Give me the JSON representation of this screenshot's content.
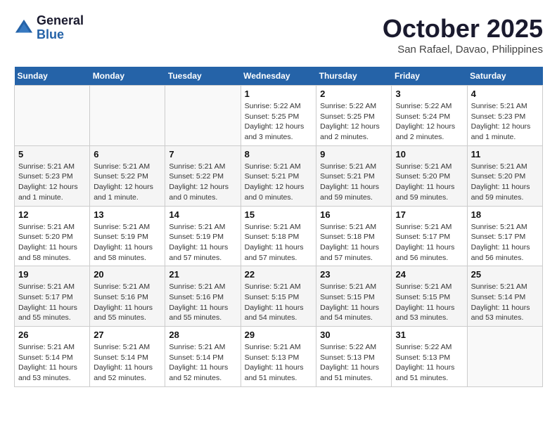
{
  "header": {
    "logo_general": "General",
    "logo_blue": "Blue",
    "month_title": "October 2025",
    "location": "San Rafael, Davao, Philippines"
  },
  "days_of_week": [
    "Sunday",
    "Monday",
    "Tuesday",
    "Wednesday",
    "Thursday",
    "Friday",
    "Saturday"
  ],
  "weeks": [
    [
      {
        "day": "",
        "info": ""
      },
      {
        "day": "",
        "info": ""
      },
      {
        "day": "",
        "info": ""
      },
      {
        "day": "1",
        "info": "Sunrise: 5:22 AM\nSunset: 5:25 PM\nDaylight: 12 hours and 3 minutes."
      },
      {
        "day": "2",
        "info": "Sunrise: 5:22 AM\nSunset: 5:25 PM\nDaylight: 12 hours and 2 minutes."
      },
      {
        "day": "3",
        "info": "Sunrise: 5:22 AM\nSunset: 5:24 PM\nDaylight: 12 hours and 2 minutes."
      },
      {
        "day": "4",
        "info": "Sunrise: 5:21 AM\nSunset: 5:23 PM\nDaylight: 12 hours and 1 minute."
      }
    ],
    [
      {
        "day": "5",
        "info": "Sunrise: 5:21 AM\nSunset: 5:23 PM\nDaylight: 12 hours and 1 minute."
      },
      {
        "day": "6",
        "info": "Sunrise: 5:21 AM\nSunset: 5:22 PM\nDaylight: 12 hours and 1 minute."
      },
      {
        "day": "7",
        "info": "Sunrise: 5:21 AM\nSunset: 5:22 PM\nDaylight: 12 hours and 0 minutes."
      },
      {
        "day": "8",
        "info": "Sunrise: 5:21 AM\nSunset: 5:21 PM\nDaylight: 12 hours and 0 minutes."
      },
      {
        "day": "9",
        "info": "Sunrise: 5:21 AM\nSunset: 5:21 PM\nDaylight: 11 hours and 59 minutes."
      },
      {
        "day": "10",
        "info": "Sunrise: 5:21 AM\nSunset: 5:20 PM\nDaylight: 11 hours and 59 minutes."
      },
      {
        "day": "11",
        "info": "Sunrise: 5:21 AM\nSunset: 5:20 PM\nDaylight: 11 hours and 59 minutes."
      }
    ],
    [
      {
        "day": "12",
        "info": "Sunrise: 5:21 AM\nSunset: 5:20 PM\nDaylight: 11 hours and 58 minutes."
      },
      {
        "day": "13",
        "info": "Sunrise: 5:21 AM\nSunset: 5:19 PM\nDaylight: 11 hours and 58 minutes."
      },
      {
        "day": "14",
        "info": "Sunrise: 5:21 AM\nSunset: 5:19 PM\nDaylight: 11 hours and 57 minutes."
      },
      {
        "day": "15",
        "info": "Sunrise: 5:21 AM\nSunset: 5:18 PM\nDaylight: 11 hours and 57 minutes."
      },
      {
        "day": "16",
        "info": "Sunrise: 5:21 AM\nSunset: 5:18 PM\nDaylight: 11 hours and 57 minutes."
      },
      {
        "day": "17",
        "info": "Sunrise: 5:21 AM\nSunset: 5:17 PM\nDaylight: 11 hours and 56 minutes."
      },
      {
        "day": "18",
        "info": "Sunrise: 5:21 AM\nSunset: 5:17 PM\nDaylight: 11 hours and 56 minutes."
      }
    ],
    [
      {
        "day": "19",
        "info": "Sunrise: 5:21 AM\nSunset: 5:17 PM\nDaylight: 11 hours and 55 minutes."
      },
      {
        "day": "20",
        "info": "Sunrise: 5:21 AM\nSunset: 5:16 PM\nDaylight: 11 hours and 55 minutes."
      },
      {
        "day": "21",
        "info": "Sunrise: 5:21 AM\nSunset: 5:16 PM\nDaylight: 11 hours and 55 minutes."
      },
      {
        "day": "22",
        "info": "Sunrise: 5:21 AM\nSunset: 5:15 PM\nDaylight: 11 hours and 54 minutes."
      },
      {
        "day": "23",
        "info": "Sunrise: 5:21 AM\nSunset: 5:15 PM\nDaylight: 11 hours and 54 minutes."
      },
      {
        "day": "24",
        "info": "Sunrise: 5:21 AM\nSunset: 5:15 PM\nDaylight: 11 hours and 53 minutes."
      },
      {
        "day": "25",
        "info": "Sunrise: 5:21 AM\nSunset: 5:14 PM\nDaylight: 11 hours and 53 minutes."
      }
    ],
    [
      {
        "day": "26",
        "info": "Sunrise: 5:21 AM\nSunset: 5:14 PM\nDaylight: 11 hours and 53 minutes."
      },
      {
        "day": "27",
        "info": "Sunrise: 5:21 AM\nSunset: 5:14 PM\nDaylight: 11 hours and 52 minutes."
      },
      {
        "day": "28",
        "info": "Sunrise: 5:21 AM\nSunset: 5:14 PM\nDaylight: 11 hours and 52 minutes."
      },
      {
        "day": "29",
        "info": "Sunrise: 5:21 AM\nSunset: 5:13 PM\nDaylight: 11 hours and 51 minutes."
      },
      {
        "day": "30",
        "info": "Sunrise: 5:22 AM\nSunset: 5:13 PM\nDaylight: 11 hours and 51 minutes."
      },
      {
        "day": "31",
        "info": "Sunrise: 5:22 AM\nSunset: 5:13 PM\nDaylight: 11 hours and 51 minutes."
      },
      {
        "day": "",
        "info": ""
      }
    ]
  ]
}
